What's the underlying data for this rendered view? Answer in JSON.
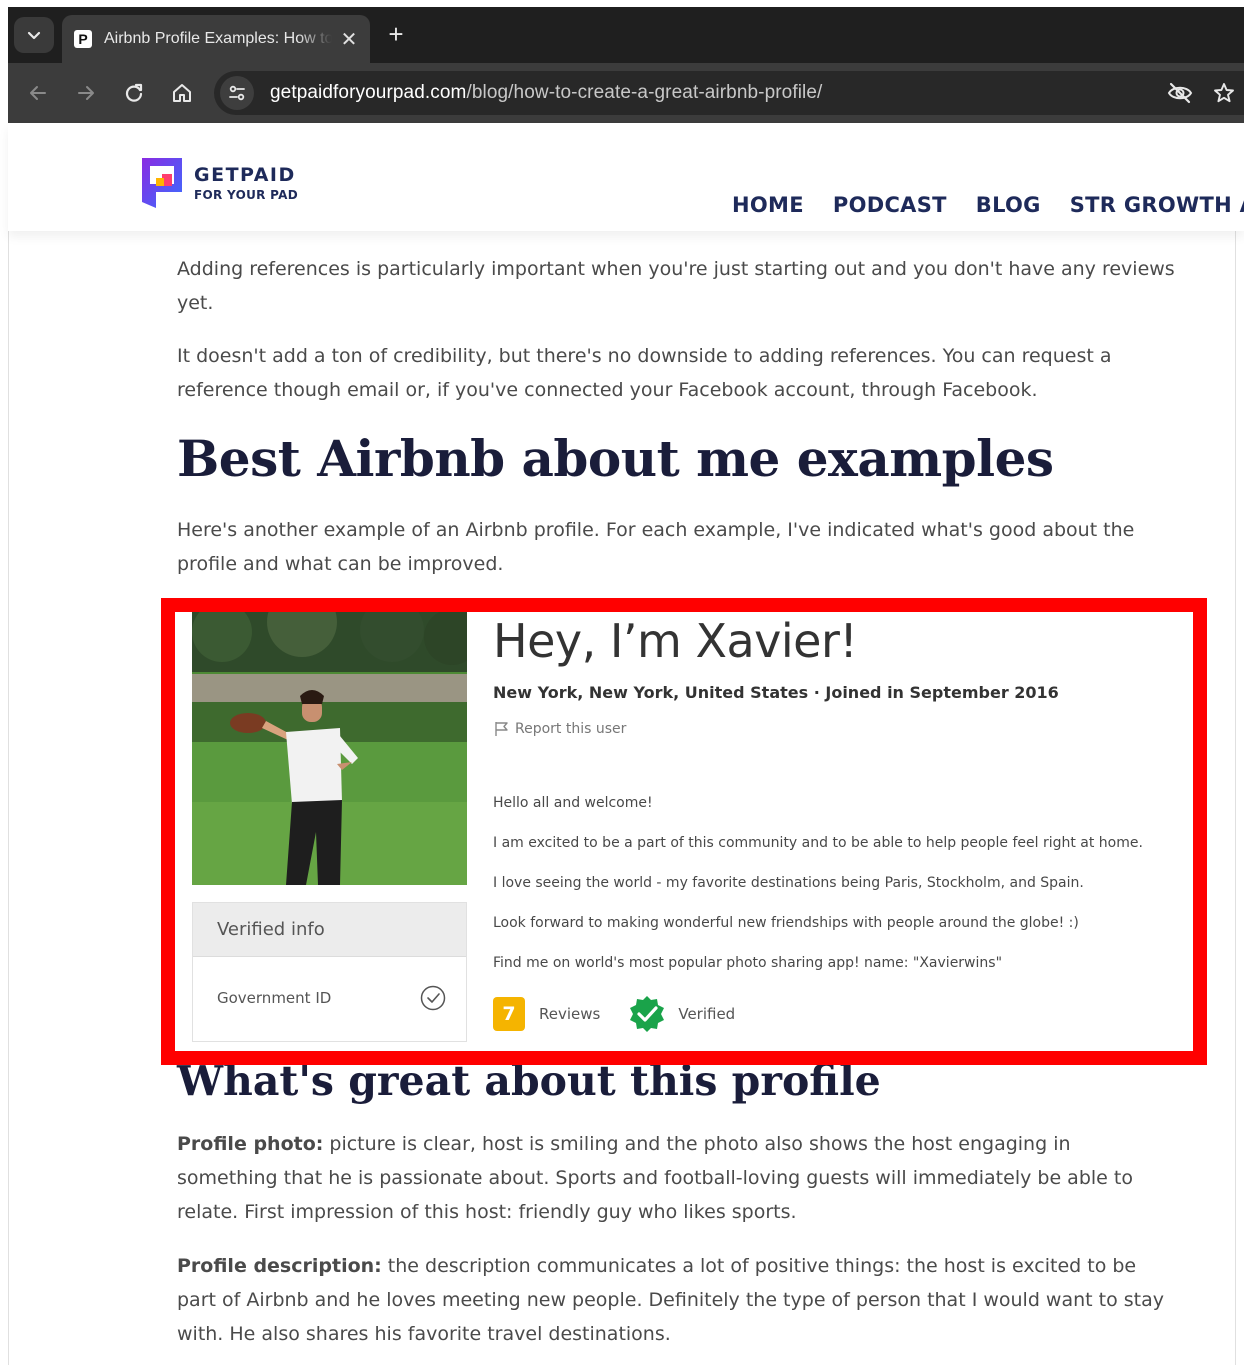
{
  "browser": {
    "tab_title": "Airbnb Profile Examples: How to Create a Great Airbnb Profile",
    "tab_favicon": "P",
    "url_host": "getpaidforyourpad.com",
    "url_path": "/blog/how-to-create-a-great-airbnb-profile/"
  },
  "site": {
    "logo_main": "GETPAID",
    "logo_sub": "FOR YOUR PAD",
    "nav": [
      "HOME",
      "PODCAST",
      "BLOG",
      "STR GROWTH ACCE"
    ]
  },
  "article": {
    "p1": "Adding references is particularly important when you're just starting out and you don't have any reviews yet.",
    "p2": "It doesn't add a ton of credibility, but there's no downside to adding references. You can request a reference though email or, if you've connected your Facebook account, through Facebook.",
    "heading1": "Best Airbnb about me examples",
    "p3": "Here's another example of an Airbnb profile. For each example, I've indicated what's good about the profile and what can be improved.",
    "heading2": "What's great about this profile",
    "p4_label": "Profile photo:",
    "p4_text": " picture is clear, host is smiling and the photo also shows the host engaging in something that he is passionate about. Sports and football-loving guests will immediately be able to relate. First impression of this host: friendly guy who likes sports.",
    "p5_label": "Profile description:",
    "p5_text": " the description communicates a lot of positive things: the host is excited to be part of Airbnb and he loves meeting new people. Definitely the type of person that I would want to stay with. He also shares his favorite travel destinations."
  },
  "profile": {
    "title": "Hey, I’m Xavier!",
    "location": "New York, New York, United States · Joined in September 2016",
    "report": "Report this user",
    "lines": [
      "Hello all and welcome!",
      "I am excited to be a part of this community and to be able to help people feel right at home.",
      "I love seeing the world - my favorite destinations being Paris, Stockholm, and Spain.",
      "Look forward to making wonderful new friendships with people around the globe! :)",
      "Find me on world's most popular photo sharing app! name: \"Xavierwins\""
    ],
    "verified_header": "Verified info",
    "gov_id": "Government ID",
    "review_count": "7",
    "reviews_label": "Reviews",
    "verified_label": "Verified"
  },
  "colors": {
    "highlight_frame": "#ff0000",
    "brand_navy": "#1e2a5a",
    "review_badge": "#f5b400",
    "verified_green": "#1aa34a"
  }
}
